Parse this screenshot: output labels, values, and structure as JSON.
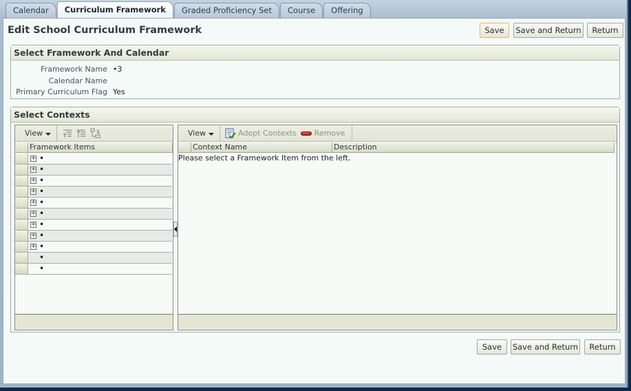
{
  "tabs": [
    {
      "label": "Calendar",
      "active": false
    },
    {
      "label": "Curriculum Framework",
      "active": true
    },
    {
      "label": "Graded Proficiency Set",
      "active": false
    },
    {
      "label": "Course",
      "active": false
    },
    {
      "label": "Offering",
      "active": false
    }
  ],
  "page": {
    "title": "Edit School Curriculum Framework"
  },
  "buttons": {
    "save": "Save",
    "save_and_return": "Save and Return",
    "return": "Return"
  },
  "framework_section": {
    "title": "Select Framework And Calendar",
    "fields": [
      {
        "label": "Framework Name",
        "value": "•3"
      },
      {
        "label": "Calendar Name",
        "value": ""
      },
      {
        "label": "Primary Curriculum Flag",
        "value": "Yes"
      }
    ]
  },
  "contexts_section": {
    "title": "Select Contexts",
    "left_panel": {
      "view_menu": "View",
      "toolbar_icons": [
        "expand-all-icon",
        "collapse-all-icon",
        "go-to-top-icon"
      ],
      "column_header": "Framework Items",
      "rows": [
        {
          "label": "•",
          "expandable": true
        },
        {
          "label": "•",
          "expandable": true
        },
        {
          "label": "•",
          "expandable": true
        },
        {
          "label": "•",
          "expandable": true
        },
        {
          "label": "•",
          "expandable": true
        },
        {
          "label": "•",
          "expandable": true
        },
        {
          "label": "•",
          "expandable": true
        },
        {
          "label": "•",
          "expandable": true
        },
        {
          "label": "•",
          "expandable": true
        },
        {
          "label": "•",
          "expandable": false
        },
        {
          "label": "•",
          "expandable": false
        }
      ]
    },
    "right_panel": {
      "view_menu": "View",
      "adopt_label": "Adopt Contexts",
      "remove_label": "Remove",
      "columns": [
        "Context Name",
        "Description"
      ],
      "empty_message": "Please select a Framework Item from the left."
    }
  },
  "colors": {
    "accent_focus": "#e3b56b",
    "remove_icon": "#c8201c"
  }
}
